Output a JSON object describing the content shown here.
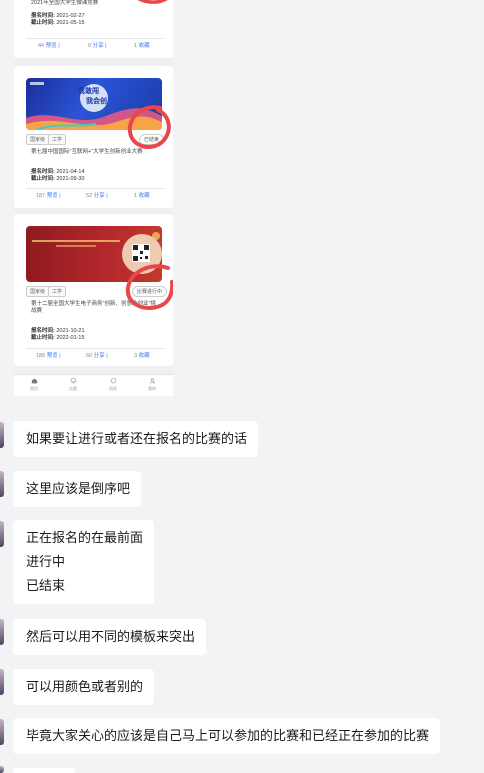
{
  "cards": [
    {
      "title": "2021年全国大学生微课竞赛",
      "reg_label": "报名时间:",
      "reg_value": "2021-02-27",
      "end_label": "截止时间:",
      "end_value": "2021-05-15",
      "views": "44",
      "views_label": "预览",
      "shares": "0",
      "shares_label": "分享",
      "favs": "1",
      "favs_label": "收藏"
    },
    {
      "banner_text_1": "我敢闯",
      "banner_text_2": "我会创",
      "tags": [
        "国家级",
        "工学"
      ],
      "status": "已结束",
      "title": "第七届中国国际\"互联网+\"大学生创新创业大赛",
      "reg_label": "报名时间:",
      "reg_value": "2021-04-14",
      "end_label": "截止时间:",
      "end_value": "2021-09-30",
      "views": "187",
      "views_label": "预览",
      "shares": "52",
      "shares_label": "分享",
      "favs": "1",
      "favs_label": "收藏"
    },
    {
      "tags": [
        "国家级",
        "工学"
      ],
      "status": "比赛进行中",
      "title": "第十二届全国大学生电子商务\"创新、创意及创业\"挑战赛",
      "reg_label": "报名时间:",
      "reg_value": "2021-10-21",
      "end_label": "截止时间:",
      "end_value": "2022-01-15",
      "views": "186",
      "views_label": "预览",
      "shares": "60",
      "shares_label": "分享",
      "favs": "3",
      "favs_label": "收藏"
    }
  ],
  "nav": [
    {
      "label": "首页",
      "icon": "home-icon"
    },
    {
      "label": "比赛",
      "icon": "trophy-icon"
    },
    {
      "label": "消息",
      "icon": "message-icon"
    },
    {
      "label": "我的",
      "icon": "user-icon"
    }
  ],
  "messages": [
    {
      "lines": [
        "如果要让进行或者还在报名的比赛的话"
      ]
    },
    {
      "lines": [
        "这里应该是倒序吧"
      ]
    },
    {
      "lines": [
        "正在报名的在最前面",
        "进行中",
        "已结束"
      ]
    },
    {
      "lines": [
        "然后可以用不同的模板来突出"
      ]
    },
    {
      "lines": [
        "可以用颜色或者别的"
      ]
    },
    {
      "lines": [
        "毕竟大家关心的应该是自己马上可以参加的比赛和已经正在参加的比赛"
      ]
    }
  ],
  "colors": {
    "link": "#3b7be0",
    "annotation": "#e8474c",
    "banner_blue": "#2146b5",
    "banner_red": "#b4282c"
  }
}
